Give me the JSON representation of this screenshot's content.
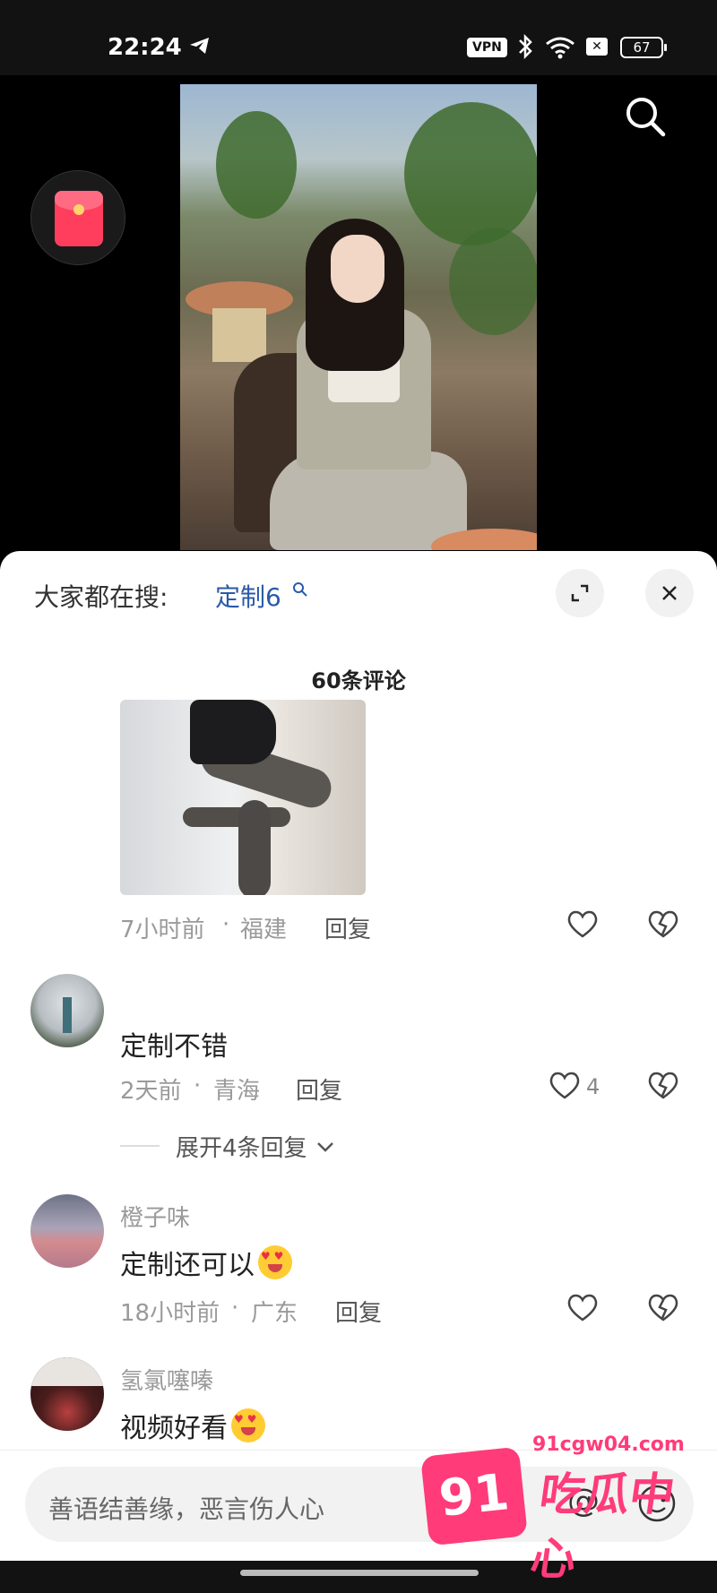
{
  "status_bar": {
    "time": "22:24",
    "vpn_label": "VPN",
    "battery": "67"
  },
  "icons": {
    "telegram": "telegram-icon",
    "bluetooth": "bluetooth-icon",
    "wifi": "wifi-icon",
    "search": "search-icon",
    "red_packet": "red-packet-icon",
    "expand": "expand-icon",
    "close": "close-icon",
    "heart": "heart-icon",
    "dislike": "broken-heart-icon",
    "image": "image-icon",
    "at": "at-icon",
    "emoji": "emoji-icon"
  },
  "sheet": {
    "trending_label": "大家都在搜:",
    "trending_keyword": "定制6",
    "comment_count": "60条评论"
  },
  "comments": [
    {
      "meta_time": "7小时前",
      "meta_sep": "·",
      "meta_loc": "福建",
      "reply": "回复"
    },
    {
      "text": "定制不错",
      "meta_time": "2天前",
      "meta_sep": "·",
      "meta_loc": "青海",
      "reply": "回复",
      "likes": "4",
      "expand": "展开4条回复"
    },
    {
      "name": "橙子味",
      "text": "定制还可以",
      "meta_time": "18小时前",
      "meta_sep": "·",
      "meta_loc": "广东",
      "reply": "回复"
    },
    {
      "name": "氢氯噻嗪",
      "text": "视频好看"
    }
  ],
  "input": {
    "placeholder": "善语结善缘，恶言伤人心"
  },
  "watermark": {
    "badge": "91",
    "url": "91cgw04.com",
    "brand": "吃瓜中心"
  },
  "colors": {
    "accent_link": "#2a5aa8",
    "watermark": "#ff3b7a"
  }
}
